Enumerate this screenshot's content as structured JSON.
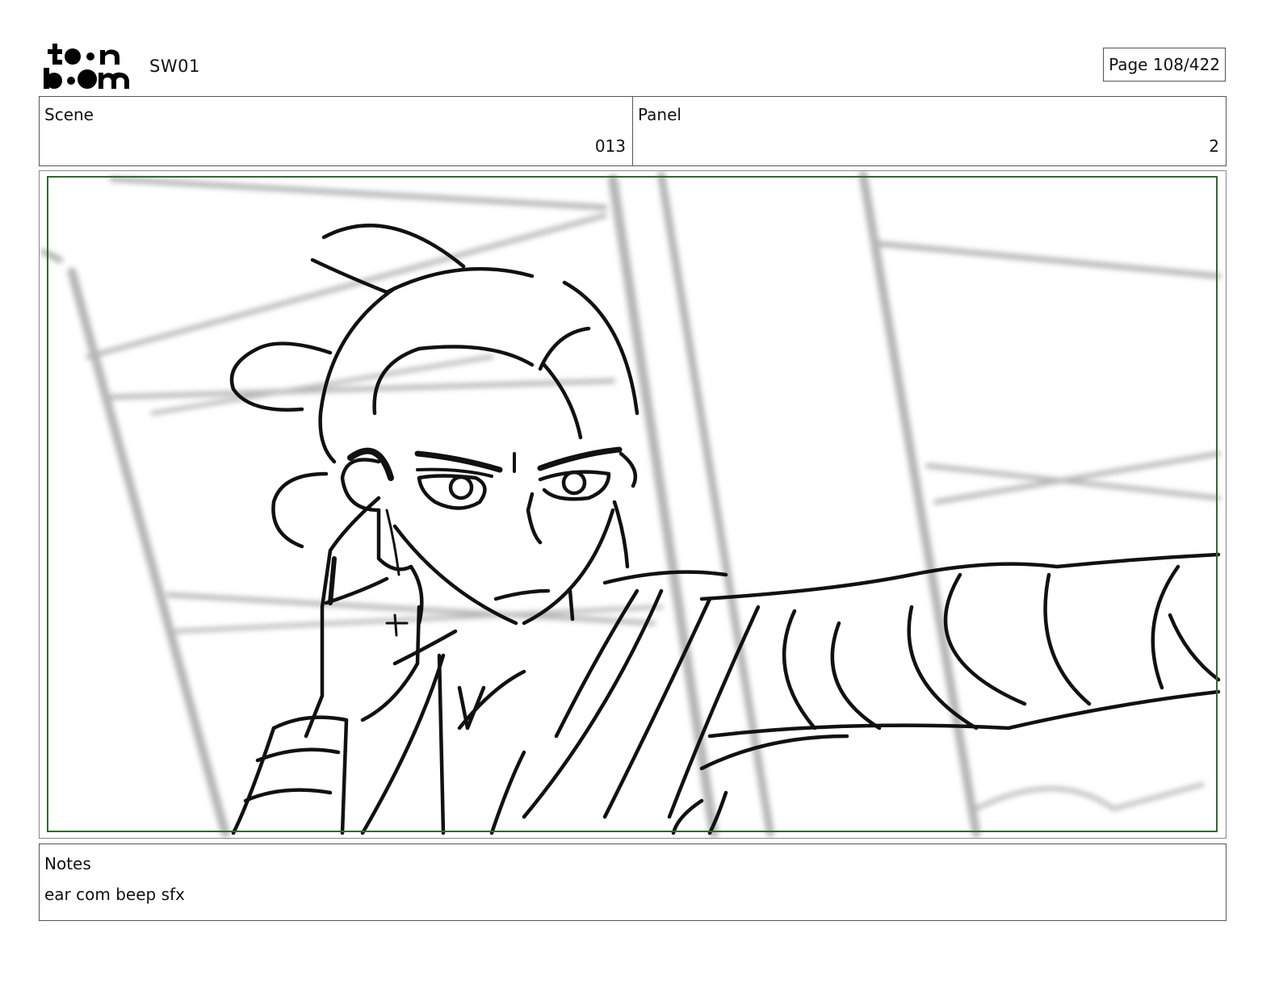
{
  "header": {
    "brand": "toon boom",
    "project": "SW01",
    "page": "Page 108/422"
  },
  "info": {
    "scene_label": "Scene",
    "scene_value": "013",
    "panel_label": "Panel",
    "panel_value": "2"
  },
  "notes": {
    "label": "Notes",
    "text": "ear com beep sfx"
  },
  "colors": {
    "safe_area_border": "#2e6b2e",
    "sketch_ink": "#111111",
    "background_lines": "#b5b5b5"
  }
}
